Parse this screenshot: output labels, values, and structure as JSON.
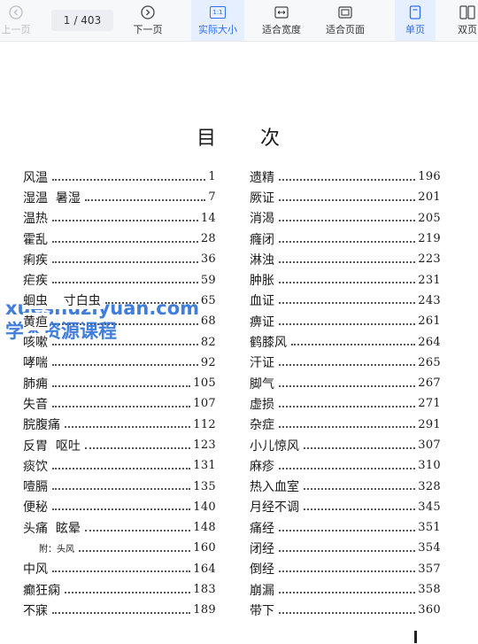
{
  "toolbar": {
    "prev_label": "上一页",
    "page_current": "1",
    "page_total": "/ 403",
    "next_label": "下一页",
    "actual_size_label": "实际大小",
    "actual_size_icon_text": "1:1",
    "fit_width_label": "适合宽度",
    "fit_page_label": "适合页面",
    "single_page_label": "单页",
    "double_page_label": "双页",
    "accent": "#2f6ef5"
  },
  "document": {
    "title_a": "目",
    "title_b": "次",
    "left": [
      {
        "t": "风温",
        "p": "1"
      },
      {
        "t": "湿温  暑湿",
        "p": "7"
      },
      {
        "t": "温热",
        "p": "14"
      },
      {
        "t": "霍乱",
        "p": "28"
      },
      {
        "t": "痢疾",
        "p": "36"
      },
      {
        "t": "疟疾",
        "p": "59"
      },
      {
        "t": "蛔虫    寸白虫",
        "p": "65"
      },
      {
        "t": "黄疸",
        "p": "68"
      },
      {
        "t": "咳嗽",
        "p": "82"
      },
      {
        "t": "哮喘",
        "p": "92"
      },
      {
        "t": "肺痈",
        "p": "105"
      },
      {
        "t": "失音",
        "p": "107"
      },
      {
        "t": "脘腹痛",
        "p": "112"
      },
      {
        "t": "反胃  呕吐",
        "p": "123"
      },
      {
        "t": "痰饮",
        "p": "131"
      },
      {
        "t": "噎膈",
        "p": "135"
      },
      {
        "t": "便秘",
        "p": "140"
      },
      {
        "t": "头痛  眩晕",
        "p": "148"
      },
      {
        "t": "附：头风",
        "p": "160",
        "small": true
      },
      {
        "t": "中风",
        "p": "164"
      },
      {
        "t": "癫狂痫",
        "p": "183"
      },
      {
        "t": "不寐",
        "p": "189"
      }
    ],
    "right": [
      {
        "t": "遗精",
        "p": "196"
      },
      {
        "t": "厥证",
        "p": "201"
      },
      {
        "t": "消渴",
        "p": "205"
      },
      {
        "t": "癃闭",
        "p": "219"
      },
      {
        "t": "淋浊",
        "p": "223"
      },
      {
        "t": "肿胀",
        "p": "231"
      },
      {
        "t": "血证",
        "p": "243"
      },
      {
        "t": "痹证",
        "p": "261"
      },
      {
        "t": "鹤膝风",
        "p": "264"
      },
      {
        "t": "汗证",
        "p": "265"
      },
      {
        "t": "脚气",
        "p": "267"
      },
      {
        "t": "虚损",
        "p": "271"
      },
      {
        "t": "杂症",
        "p": "291"
      },
      {
        "t": "小儿惊风",
        "p": "307"
      },
      {
        "t": "麻疹",
        "p": "310"
      },
      {
        "t": "热入血室",
        "p": "328"
      },
      {
        "t": "月经不调",
        "p": "345"
      },
      {
        "t": "痛经",
        "p": "351"
      },
      {
        "t": "闭经",
        "p": "354"
      },
      {
        "t": "倒经",
        "p": "357"
      },
      {
        "t": "崩漏",
        "p": "358"
      },
      {
        "t": "带下",
        "p": "360"
      }
    ]
  },
  "watermark": {
    "line1": "xueshuziyuan.com",
    "line2": "学术资源课程"
  }
}
